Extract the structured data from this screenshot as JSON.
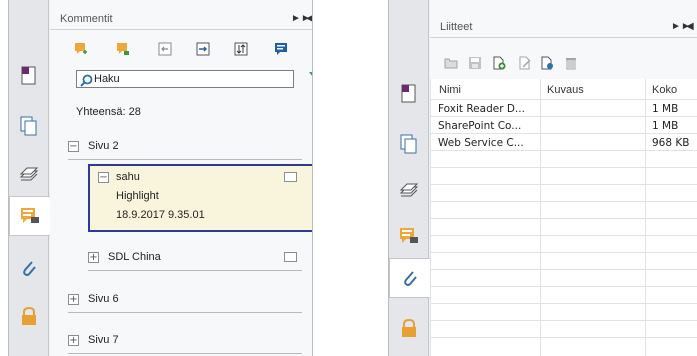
{
  "comments_panel": {
    "title": "Kommentit",
    "search": {
      "value": "Haku"
    },
    "total": "Yhteensä: 28",
    "pages": [
      {
        "label": "Sivu 2",
        "expanded": true
      },
      {
        "label": "Sivu 6",
        "expanded": false
      },
      {
        "label": "Sivu 7",
        "expanded": false
      }
    ],
    "selected_comment": {
      "author": "sahu",
      "type": "Highlight",
      "date": "18.9.2017 9.35.01"
    },
    "collapsed_comment": {
      "author": "SDL China"
    }
  },
  "attachments_panel": {
    "title": "Liitteet",
    "columns": [
      "Nimi",
      "Kuvaus",
      "Koko"
    ],
    "rows": [
      {
        "name": "Foxit Reader D...",
        "desc": "",
        "size": "1 MB"
      },
      {
        "name": "SharePoint Co...",
        "desc": "",
        "size": "1 MB"
      },
      {
        "name": "Web Service C...",
        "desc": "",
        "size": "968 KB"
      }
    ]
  },
  "colors": {
    "accent_blue": "#2e3a96",
    "highlight_bg": "#f8f5dc",
    "panel_bg": "#f1f2f4"
  }
}
